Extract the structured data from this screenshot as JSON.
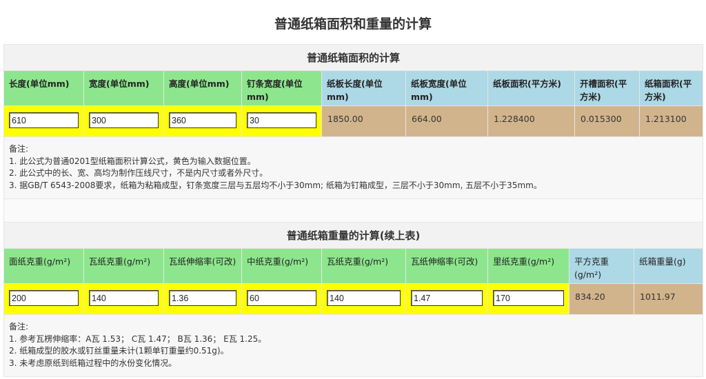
{
  "page": {
    "title": "普通纸箱面积和重量的计算"
  },
  "area": {
    "title": "普通纸箱面积的计算",
    "headers": [
      "长度(单位mm)",
      "宽度(单位mm)",
      "高度(单位mm)",
      "钉条宽度(单位mm)",
      "纸板长度(单位mm)",
      "纸板宽度(单位mm)",
      "纸板面积(平方米)",
      "开槽面积(平方米)",
      "纸箱面积(平方米)"
    ],
    "inputs": [
      "610",
      "300",
      "360",
      "30"
    ],
    "outputs": [
      "1850.00",
      "664.00",
      "1.228400",
      "0.015300",
      "1.213100"
    ],
    "notes": [
      "备注:",
      "1. 此公式为普通0201型纸箱面积计算公式，黄色为输入数据位置。",
      "2. 此公式中的长、宽、高均为制作压线尺寸，不是内尺寸或者外尺寸。",
      "3. 据GB/T 6543-2008要求，纸箱为粘箱成型，钉条宽度三层与五层均不小于30mm; 纸箱为钉箱成型，三层不小于30mm, 五层不小于35mm。"
    ]
  },
  "weight": {
    "title": "普通纸箱重量的计算(续上表)",
    "headers": [
      "面纸克重(g/m²)",
      "瓦纸克重(g/m²)",
      "瓦纸伸缩率(可改)",
      "中纸克重(g/m²)",
      "瓦纸克重(g/m²)",
      "瓦纸伸缩率(可改)",
      "里纸克重(g/m²)",
      "平方克重(g/m²)",
      "纸箱重量(g)"
    ],
    "inputs": [
      "200",
      "140",
      "1.36",
      "60",
      "140",
      "1.47",
      "170"
    ],
    "outputs": [
      "834.20",
      "1011.97"
    ],
    "notes": [
      "备注:",
      "1. 参考瓦楞伸缩率：A瓦 1.53； C瓦 1.47； B瓦 1.36； E瓦 1.25。",
      "2. 纸箱成型的胶水或钉丝重量未计(1颗单钉重量约0.51g)。",
      "3. 未考虑原纸到纸箱过程中的水份变化情况。"
    ]
  }
}
